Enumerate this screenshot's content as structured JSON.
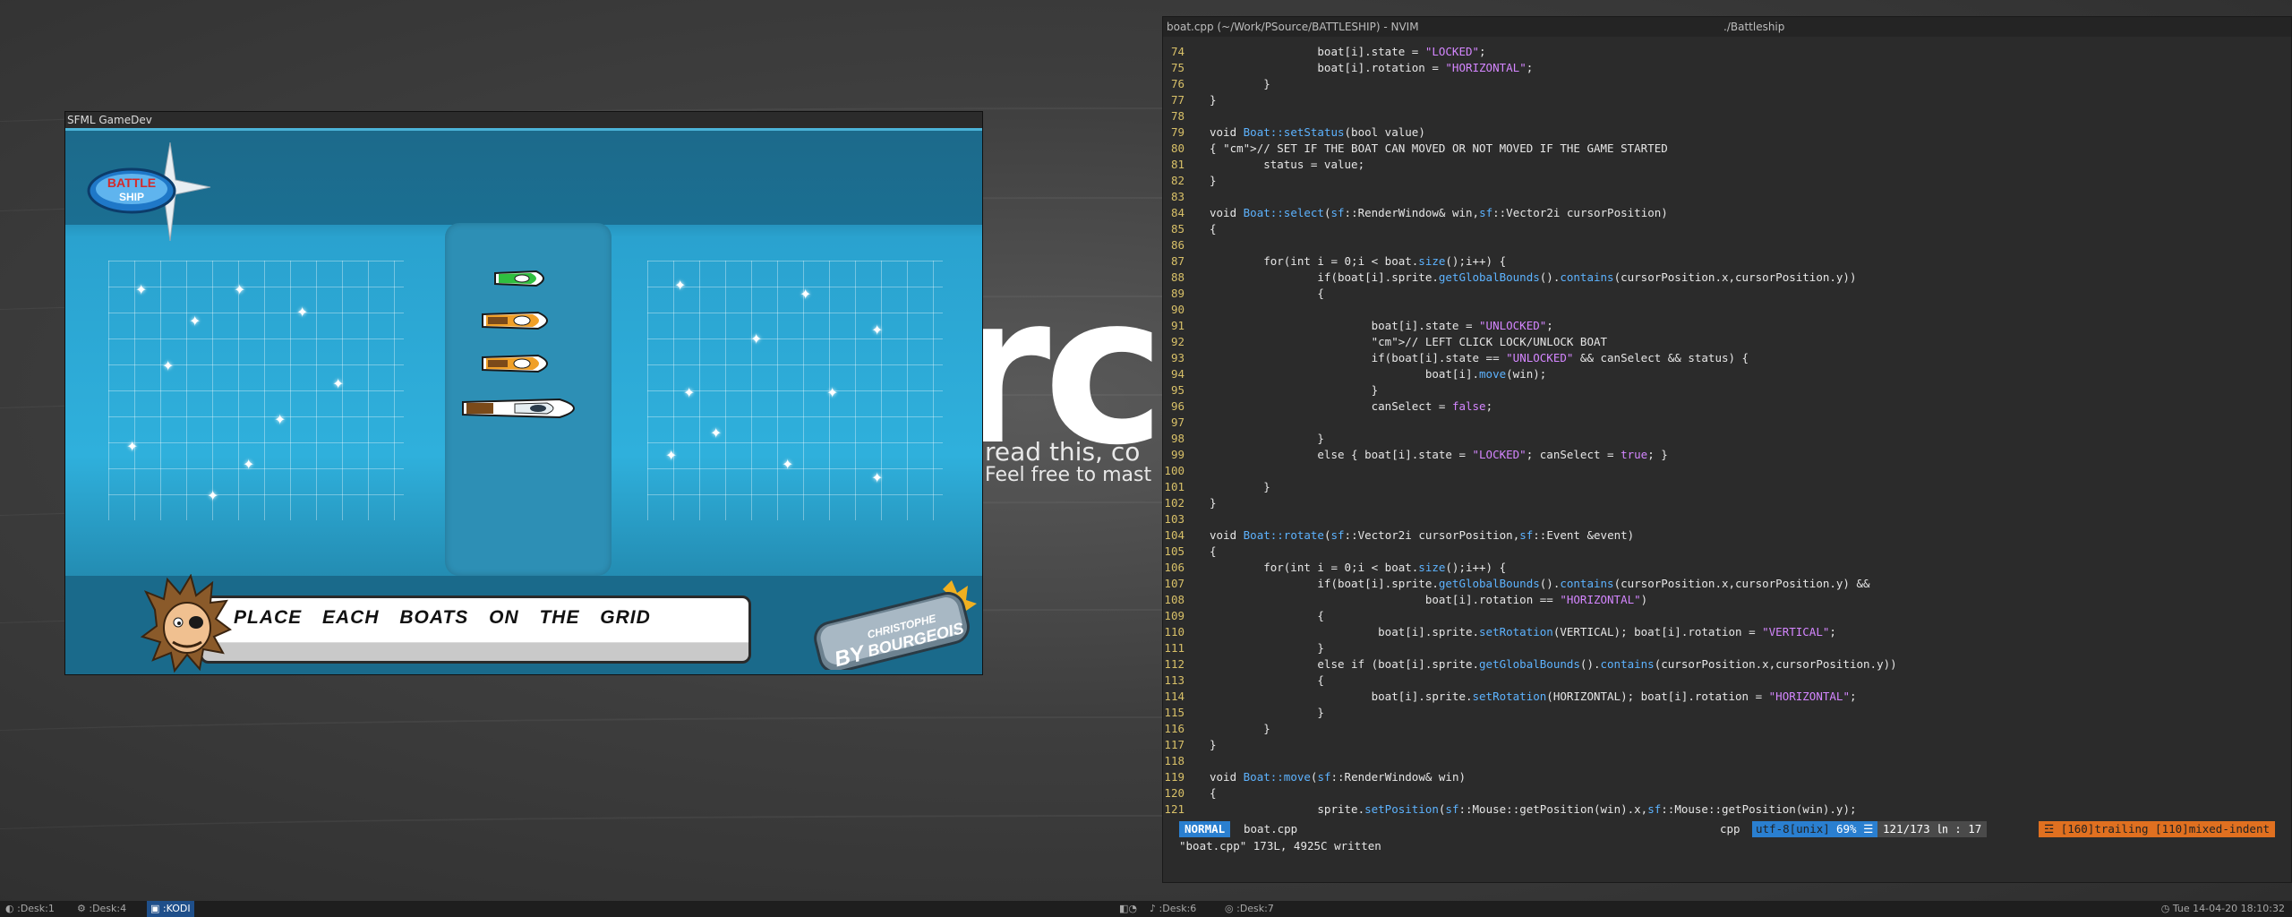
{
  "wallpaper": {
    "word": "rcl",
    "line1": "read this, co",
    "line2": "Feel free to mast"
  },
  "game_window": {
    "title": "SFML GameDev",
    "logo_text_top": "BATTLE",
    "logo_text_bottom": "SHIP",
    "message": "PLACE EACH BOATS ON THE GRID",
    "author_by": "BY",
    "author_first": "CHRISTOPHE",
    "author_last": "BOURGEOIS"
  },
  "terminal": {
    "title": "boat.cpp (~/Work/PSource/BATTLESHIP) - NVIM",
    "title_right": "./Battleship",
    "lines": [
      {
        "n": "74",
        "t": "                boat[i].state = \"LOCKED\";"
      },
      {
        "n": "75",
        "t": "                boat[i].rotation = \"HORIZONTAL\";"
      },
      {
        "n": "76",
        "t": "        }"
      },
      {
        "n": "77",
        "t": "}"
      },
      {
        "n": "78",
        "t": ""
      },
      {
        "n": "79",
        "t": "void Boat::setStatus(bool value)"
      },
      {
        "n": "80",
        "t": "{ // SET IF THE BOAT CAN MOVED OR NOT MOVED IF THE GAME STARTED"
      },
      {
        "n": "81",
        "t": "        status = value;"
      },
      {
        "n": "82",
        "t": "}"
      },
      {
        "n": "83",
        "t": ""
      },
      {
        "n": "84",
        "t": "void Boat::select(sf::RenderWindow& win,sf::Vector2i cursorPosition)"
      },
      {
        "n": "85",
        "t": "{"
      },
      {
        "n": "86",
        "t": ""
      },
      {
        "n": "87",
        "t": "        for(int i = 0;i < boat.size();i++) {"
      },
      {
        "n": "88",
        "t": "                if(boat[i].sprite.getGlobalBounds().contains(cursorPosition.x,cursorPosition.y))"
      },
      {
        "n": "89",
        "t": "                {"
      },
      {
        "n": "90",
        "t": ""
      },
      {
        "n": "91",
        "t": "                        boat[i].state = \"UNLOCKED\";"
      },
      {
        "n": "92",
        "t": "                        // LEFT CLICK LOCK/UNLOCK BOAT"
      },
      {
        "n": "93",
        "t": "                        if(boat[i].state == \"UNLOCKED\" && canSelect && status) {"
      },
      {
        "n": "94",
        "t": "                                boat[i].move(win);"
      },
      {
        "n": "95",
        "t": "                        }"
      },
      {
        "n": "96",
        "t": "                        canSelect = false;"
      },
      {
        "n": "97",
        "t": ""
      },
      {
        "n": "98",
        "t": "                }"
      },
      {
        "n": "99",
        "t": "                else { boat[i].state = \"LOCKED\"; canSelect = true; }"
      },
      {
        "n": "100",
        "t": ""
      },
      {
        "n": "101",
        "t": "        }"
      },
      {
        "n": "102",
        "t": "}"
      },
      {
        "n": "103",
        "t": ""
      },
      {
        "n": "104",
        "t": "void Boat::rotate(sf::Vector2i cursorPosition,sf::Event &event)"
      },
      {
        "n": "105",
        "t": "{"
      },
      {
        "n": "106",
        "t": "        for(int i = 0;i < boat.size();i++) {"
      },
      {
        "n": "107",
        "t": "                if(boat[i].sprite.getGlobalBounds().contains(cursorPosition.x,cursorPosition.y) &&"
      },
      {
        "n": "108",
        "t": "                                boat[i].rotation == \"HORIZONTAL\")"
      },
      {
        "n": "109",
        "t": "                {"
      },
      {
        "n": "110",
        "t": "                         boat[i].sprite.setRotation(VERTICAL); boat[i].rotation = \"VERTICAL\";"
      },
      {
        "n": "111",
        "t": "                }"
      },
      {
        "n": "112",
        "t": "                else if (boat[i].sprite.getGlobalBounds().contains(cursorPosition.x,cursorPosition.y))"
      },
      {
        "n": "113",
        "t": "                {"
      },
      {
        "n": "114",
        "t": "                        boat[i].sprite.setRotation(HORIZONTAL); boat[i].rotation = \"HORIZONTAL\";"
      },
      {
        "n": "115",
        "t": "                }"
      },
      {
        "n": "116",
        "t": "        }"
      },
      {
        "n": "117",
        "t": "}"
      },
      {
        "n": "118",
        "t": ""
      },
      {
        "n": "119",
        "t": "void Boat::move(sf::RenderWindow& win)"
      },
      {
        "n": "120",
        "t": "{"
      },
      {
        "n": "121",
        "t": "                sprite.setPosition(sf::Mouse::getPosition(win).x,sf::Mouse::getPosition(win).y);"
      }
    ],
    "status": {
      "mode": "NORMAL",
      "file": "boat.cpp",
      "filetype": "cpp",
      "encoding": "utf-8[unix]",
      "percent": "69% ☰",
      "position": "121/173 ㏑ : 17",
      "warnings": "☲ [160]trailing [110]mixed-indent"
    },
    "cmdline": "\"boat.cpp\" 173L, 4925C written"
  },
  "taskbar": {
    "items_left": [
      ":Desk:1",
      ":Desk:4",
      ":KODI"
    ],
    "items_center": [
      ":Desk:6",
      ":Desk:7"
    ],
    "clock": "Tue 14-04-20 18:10:32"
  }
}
